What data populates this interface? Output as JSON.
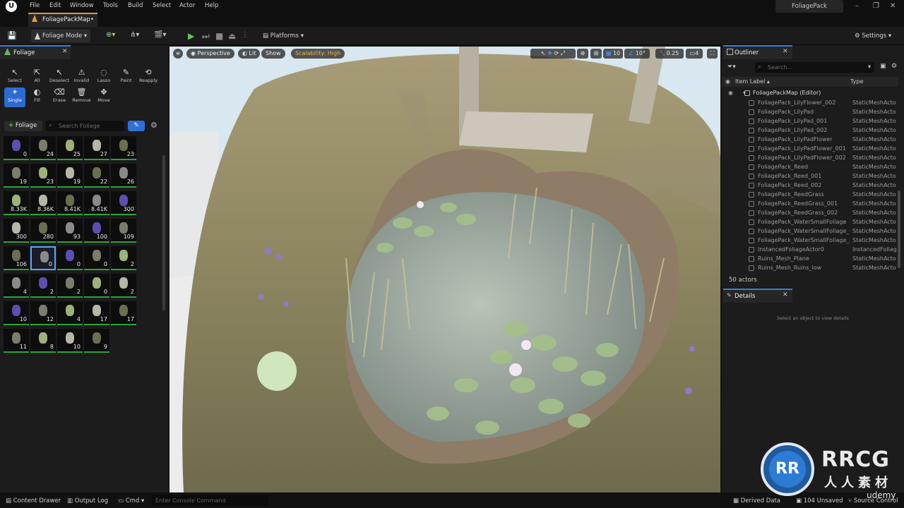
{
  "menubar": {
    "logo": "U",
    "items": [
      "File",
      "Edit",
      "Window",
      "Tools",
      "Build",
      "Select",
      "Actor",
      "Help"
    ],
    "project": "FoliagePack"
  },
  "doc_tab": "FoliagePackMap•",
  "toolbar": {
    "mode_label": "Foliage Mode",
    "platforms_label": "Platforms",
    "settings_label": "Settings"
  },
  "left_panel": {
    "tab_label": "Foliage",
    "tools": [
      {
        "label": "Select",
        "icon": "↖"
      },
      {
        "label": "All",
        "icon": "⇱"
      },
      {
        "label": "Deselect",
        "icon": "↖"
      },
      {
        "label": "Invalid",
        "icon": "⚠"
      },
      {
        "label": "Lasso",
        "icon": "◌"
      },
      {
        "label": "Paint",
        "icon": "✎"
      },
      {
        "label": "Reapply",
        "icon": "⟲"
      }
    ],
    "tools2": [
      {
        "label": "Single",
        "icon": "✦",
        "selected": true
      },
      {
        "label": "Fill",
        "icon": "◐"
      },
      {
        "label": "Erase",
        "icon": "⌫"
      },
      {
        "label": "Remove",
        "icon": "🗑"
      },
      {
        "label": "Move",
        "icon": "✥"
      }
    ],
    "add_label": "Foliage",
    "search_placeholder": "Search Foliage",
    "counts": [
      [
        "0",
        "24",
        "25",
        "27",
        "23"
      ],
      [
        "19",
        "23",
        "19",
        "22",
        "26"
      ],
      [
        "8.33K",
        "8.36K",
        "8.41K",
        "8.41K",
        "300"
      ],
      [
        "300",
        "280",
        "93",
        "100",
        "109"
      ],
      [
        "106",
        "0",
        "0",
        "0",
        "2"
      ],
      [
        "4",
        "2",
        "2",
        "0",
        "2"
      ],
      [
        "10",
        "12",
        "4",
        "17",
        "17"
      ],
      [
        "11",
        "8",
        "10",
        "9"
      ]
    ]
  },
  "viewport": {
    "perspective": "Perspective",
    "lit": "Lit",
    "show": "Show",
    "scalability": "Scalability: High",
    "grid_snap": "10",
    "rot_snap": "10°",
    "scale_snap": "0.25",
    "cam_speed": "4"
  },
  "outliner": {
    "tab_label": "Outliner",
    "search_placeholder": "Search...",
    "col_label": "Item Label ▴",
    "col_type": "Type",
    "root": "FoliagePackMap (Editor)",
    "rows": [
      {
        "name": "FoliagePack_LilyFlower_002",
        "type": "StaticMeshActo"
      },
      {
        "name": "FoliagePack_LilyPad",
        "type": "StaticMeshActo"
      },
      {
        "name": "FoliagePack_LilyPad_001",
        "type": "StaticMeshActo"
      },
      {
        "name": "FoliagePack_LilyPad_002",
        "type": "StaticMeshActo"
      },
      {
        "name": "FoliagePack_LilyPadFlower",
        "type": "StaticMeshActo"
      },
      {
        "name": "FoliagePack_LilyPadFlower_001",
        "type": "StaticMeshActo"
      },
      {
        "name": "FoliagePack_LilyPadFlower_002",
        "type": "StaticMeshActo"
      },
      {
        "name": "FoliagePack_Reed",
        "type": "StaticMeshActo"
      },
      {
        "name": "FoliagePack_Reed_001",
        "type": "StaticMeshActo"
      },
      {
        "name": "FoliagePack_Reed_002",
        "type": "StaticMeshActo"
      },
      {
        "name": "FoliagePack_ReedGrass",
        "type": "StaticMeshActo"
      },
      {
        "name": "FoliagePack_ReedGrass_001",
        "type": "StaticMeshActo"
      },
      {
        "name": "FoliagePack_ReedGrass_002",
        "type": "StaticMeshActo"
      },
      {
        "name": "FoliagePack_WaterSmallFoliage",
        "type": "StaticMeshActo"
      },
      {
        "name": "FoliagePack_WaterSmallFoliage_C",
        "type": "StaticMeshActo"
      },
      {
        "name": "FoliagePack_WaterSmallFoliage_C",
        "type": "StaticMeshActo"
      },
      {
        "name": "InstancedFoliageActor0",
        "type": "InstancedFoliag"
      },
      {
        "name": "Ruins_Mesh_Plane",
        "type": "StaticMeshActo"
      },
      {
        "name": "Ruins_Mesh_Ruins_low",
        "type": "StaticMeshActo"
      }
    ],
    "count": "50 actors"
  },
  "details": {
    "tab_label": "Details",
    "empty_msg": "Select an object to view details"
  },
  "statusbar": {
    "content_drawer": "Content Drawer",
    "output_log": "Output Log",
    "cmd": "Cmd",
    "console_placeholder": "Enter Console Command",
    "derived_data": "Derived Data",
    "unsaved": "104 Unsaved",
    "source_control": "Source Control"
  },
  "watermark": {
    "logo": "RR",
    "line1": "RRCG",
    "line2": "人人素材",
    "udemy": "udemy"
  }
}
